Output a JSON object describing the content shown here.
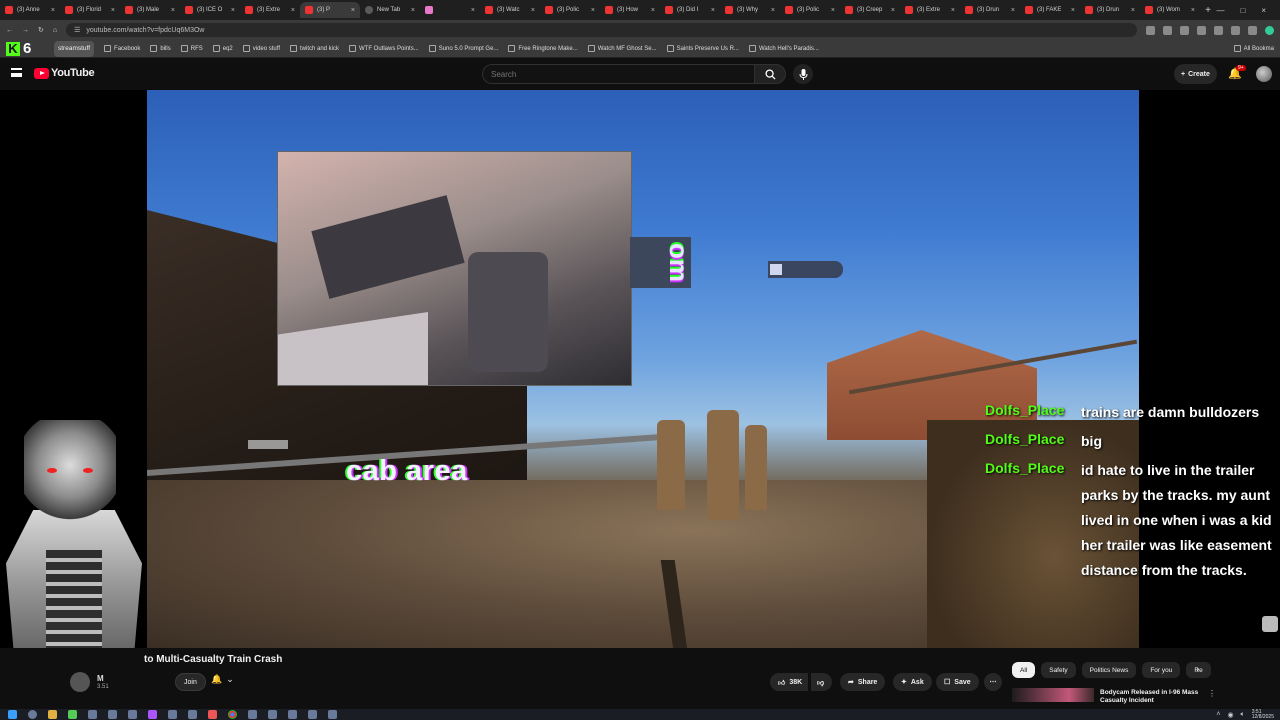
{
  "browser": {
    "tabs": [
      {
        "label": "(3) Anne",
        "active": false
      },
      {
        "label": "(3) Florid",
        "active": false
      },
      {
        "label": "(3) Male",
        "active": false
      },
      {
        "label": "(3) ICE O",
        "active": false
      },
      {
        "label": "(3) Extre",
        "active": false
      },
      {
        "label": "(3) P",
        "active": true
      },
      {
        "label": "New Tab",
        "active": false
      },
      {
        "label": "",
        "active": false
      },
      {
        "label": "(3) Watc",
        "active": false
      },
      {
        "label": "(3) Polic",
        "active": false
      },
      {
        "label": "(3) How",
        "active": false
      },
      {
        "label": "(3) Did I",
        "active": false
      },
      {
        "label": "(3) Why",
        "active": false
      },
      {
        "label": "(3) Polic",
        "active": false
      },
      {
        "label": "(3) Creep",
        "active": false
      },
      {
        "label": "(3) Extre",
        "active": false
      },
      {
        "label": "(3) Drun",
        "active": false
      },
      {
        "label": "(3) FAKE",
        "active": false
      },
      {
        "label": "(3) Drun",
        "active": false
      },
      {
        "label": "(3) Wom",
        "active": false
      }
    ],
    "url": "youtube.com/watch?v=fpdcUq6M3Ow",
    "bookmarks": [
      {
        "label": "streamstuff",
        "chip": true
      },
      {
        "label": "Facebook",
        "chip": false
      },
      {
        "label": "bills",
        "chip": false
      },
      {
        "label": "RFS",
        "chip": false
      },
      {
        "label": "eq2",
        "chip": false
      },
      {
        "label": "video stuff",
        "chip": false
      },
      {
        "label": "twitch and kick",
        "chip": false
      },
      {
        "label": "WTF Outlaws Points...",
        "chip": false
      },
      {
        "label": "Suno 5.0 Prompt Ge...",
        "chip": false
      },
      {
        "label": "Free Ringtone Make...",
        "chip": false
      },
      {
        "label": "Watch MF Ghost Se...",
        "chip": false
      },
      {
        "label": "Saints Preserve Us R...",
        "chip": false
      },
      {
        "label": "Watch Hell's Paradis...",
        "chip": false
      }
    ],
    "all_bookmarks": "All Bookma",
    "k6_logo_text": "K",
    "k6_logo_num": "6"
  },
  "youtube": {
    "logo_text": "YouTube",
    "search_placeholder": "Search",
    "create_label": "Create",
    "notif_count": "9+",
    "video": {
      "overlay_text": "cab area",
      "glitch_text": "om",
      "title": "to Multi-Casualty Train Crash",
      "channel_name": "M",
      "channel_subs": "3.51",
      "join_label": "Join",
      "likes": "38K",
      "share_label": "Share",
      "ask_label": "Ask",
      "save_label": "Save"
    },
    "chat": [
      {
        "user": "Dolfs_Place",
        "message": "trains are damn bulldozers"
      },
      {
        "user": "Dolfs_Place",
        "message": "big"
      },
      {
        "user": "Dolfs_Place",
        "message": "id hate to live in the trailer parks by the tracks. my aunt lived in one when i was a kid her trailer was like easement distance from the tracks."
      }
    ],
    "chips": [
      {
        "label": "All",
        "active": true
      },
      {
        "label": "Safety",
        "active": false
      },
      {
        "label": "Politics News",
        "active": false
      },
      {
        "label": "For you",
        "active": false
      },
      {
        "label": "Re",
        "active": false
      }
    ],
    "related": {
      "title": "Bodycam Released in I-96 Mass Casualty Incident"
    }
  },
  "taskbar": {
    "time": "3:51",
    "date": "12/8/2025"
  },
  "colors": {
    "chat_user": "#53fc18",
    "yt_red": "#ff0033",
    "background": "#0f0f0f"
  }
}
